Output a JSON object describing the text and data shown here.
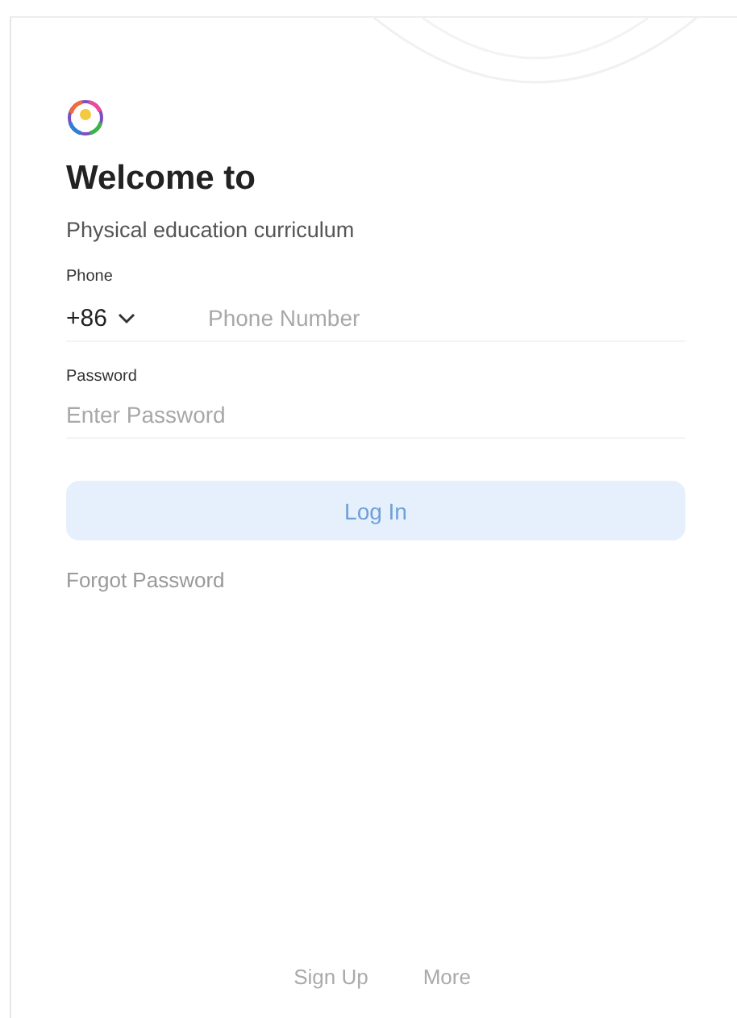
{
  "title": "Welcome to",
  "subtitle": "Physical education curriculum",
  "phone": {
    "label": "Phone",
    "country_code": "+86",
    "placeholder": "Phone Number"
  },
  "password": {
    "label": "Password",
    "placeholder": "Enter Password"
  },
  "login_button": {
    "label": "Log In",
    "disabled": true
  },
  "forgot_link": "Forgot Password",
  "footer_links": [
    "Sign Up",
    "More"
  ]
}
